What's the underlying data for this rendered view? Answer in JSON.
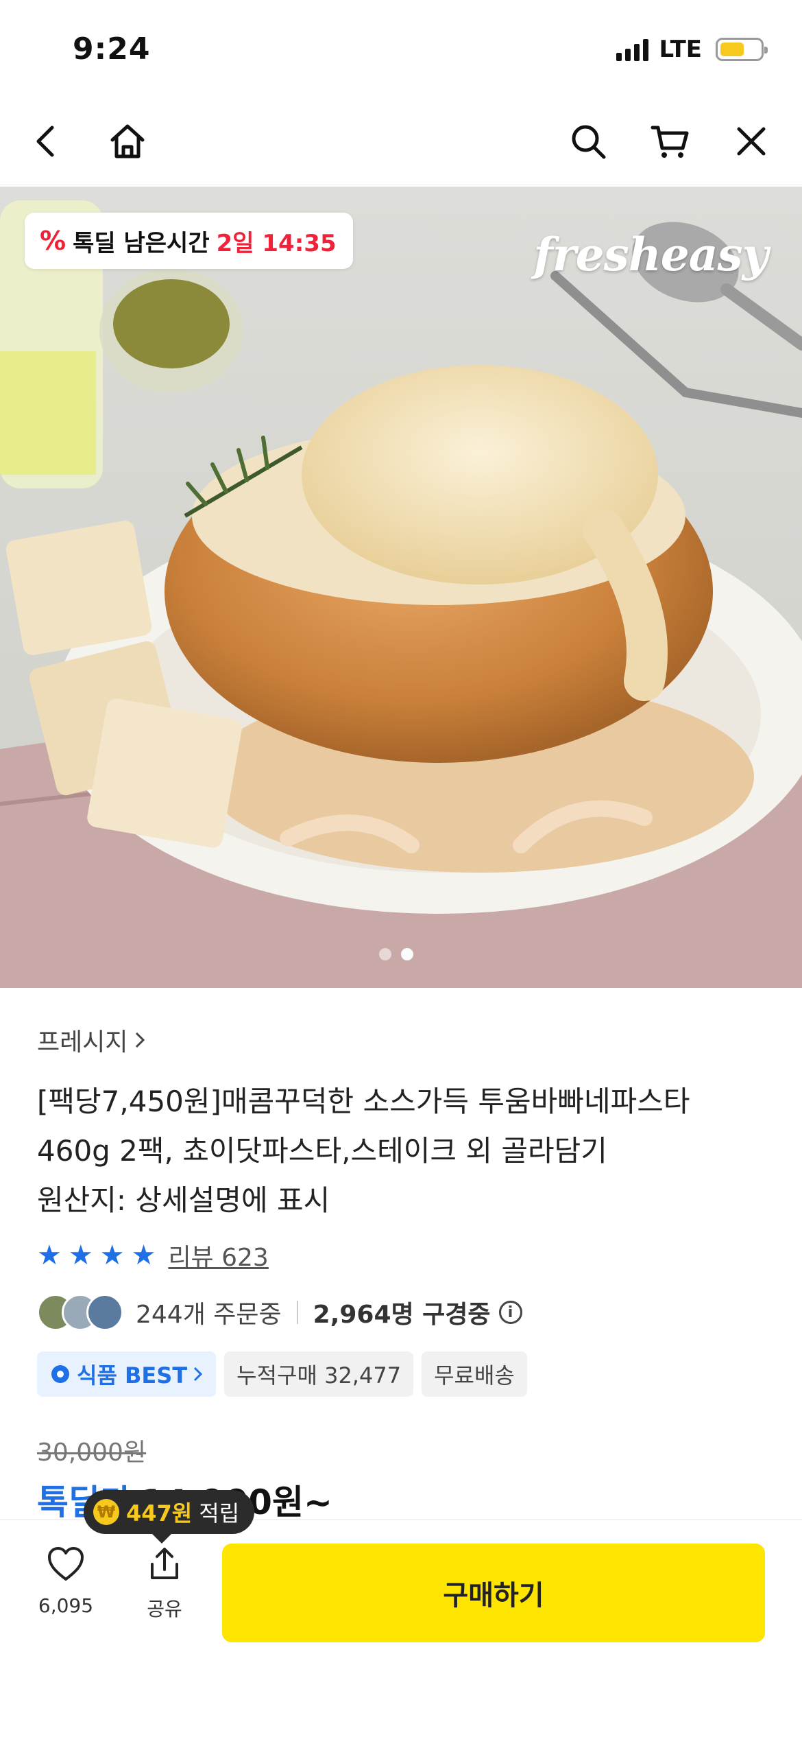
{
  "status_bar": {
    "time": "9:24",
    "network": "LTE"
  },
  "nav": {
    "icons": [
      "back-icon",
      "home-icon",
      "search-icon",
      "cart-icon",
      "close-icon"
    ]
  },
  "hero": {
    "deal_label": "톡딜 남은시간",
    "deal_time": "2일 14:35",
    "brand_logo": "fresheasy",
    "carousel": {
      "total": 2,
      "active": 1
    }
  },
  "product": {
    "seller": "프레시지",
    "title_line1": "[팩당7,450원]매콤꾸덕한 소스가득 투움바빠네파스타",
    "title_line2": "460g 2팩, 쵸이닷파스타,스테이크 외 골라담기",
    "title_line3": "원산지: 상세설명에 표시",
    "rating_stars": 4,
    "review_label": "리뷰 623",
    "orders": "244개 주문중",
    "viewers": "2,964명 구경중",
    "badges": {
      "best": "식품 BEST",
      "cumulative": "누적구매 32,477",
      "shipping": "무료배송"
    },
    "original_price": "30,000원",
    "deal_price_label": "톡딜가",
    "deal_price": "14,900원~"
  },
  "bottom": {
    "points_amount": "447원",
    "points_label": "적립",
    "like_count": "6,095",
    "share_label": "공유",
    "buy_label": "구매하기"
  },
  "colors": {
    "accent_blue": "#1f6fe5",
    "buy_yellow": "#fee500",
    "deal_red": "#f0223a"
  }
}
